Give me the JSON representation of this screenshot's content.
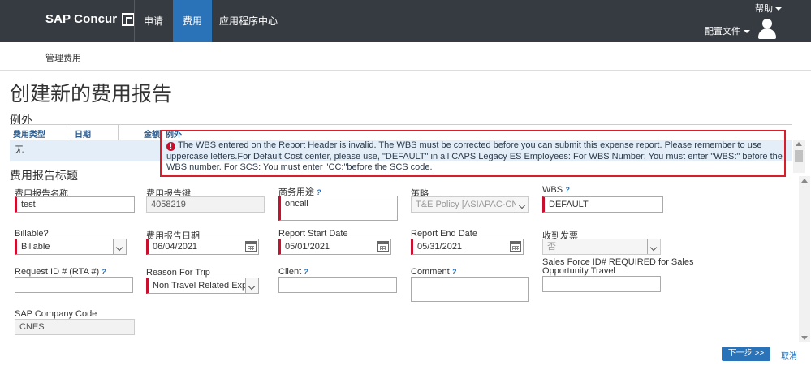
{
  "nav": {
    "brand": "SAP Concur",
    "tabs": [
      "申请",
      "费用",
      "应用程序中心"
    ],
    "help": "帮助",
    "profile": "配置文件"
  },
  "subnav": {
    "manage": "管理费用"
  },
  "page": {
    "title": "创建新的费用报告"
  },
  "exceptions": {
    "title": "例外",
    "columns": [
      "费用类型",
      "日期",
      "金额",
      "例外"
    ],
    "row_value": "无",
    "message": "The WBS entered on the Report Header is invalid. The WBS must be corrected before you can submit this expense report. Please remember to use uppercase letters.For Default Cost center, please use, \"DEFAULT\" in all CAPS Legacy ES Employees: For WBS Number: You must enter \"WBS:\" before the WBS number. For SCS: You must enter \"CC:\"before the SCS code."
  },
  "form": {
    "section_title": "费用报告标题",
    "report_name": {
      "label": "费用报告名称",
      "value": "test"
    },
    "report_key": {
      "label": "费用报告键",
      "value": "4058219"
    },
    "business_purpose": {
      "label": "商务用途",
      "value": "oncall"
    },
    "policy": {
      "label": "策略",
      "value": "T&E Policy [ASIAPAC-CN]"
    },
    "wbs": {
      "label": "WBS",
      "value": "DEFAULT"
    },
    "billable": {
      "label": "Billable?",
      "value": "Billable"
    },
    "report_date": {
      "label": "费用报告日期",
      "value": "06/04/2021"
    },
    "start_date": {
      "label": "Report Start Date",
      "value": "05/01/2021"
    },
    "end_date": {
      "label": "Report End Date",
      "value": "05/31/2021"
    },
    "receipt": {
      "label": "收到发票",
      "value": "否"
    },
    "request_id": {
      "label": "Request ID # (RTA #)",
      "value": ""
    },
    "reason": {
      "label": "Reason For Trip",
      "value": "Non Travel Related Expen"
    },
    "client": {
      "label": "Client",
      "value": ""
    },
    "comment": {
      "label": "Comment",
      "value": ""
    },
    "sales_force": {
      "label_line1": "Sales Force ID# REQUIRED for Sales",
      "label_line2": "Opportunity Travel",
      "value": ""
    },
    "company_code": {
      "label": "SAP Company Code",
      "value": "CNES"
    }
  },
  "actions": {
    "next": "下一步 >>",
    "cancel": "取消"
  },
  "colors": {
    "nav_bg": "#363b41",
    "accent": "#2a73b9",
    "error": "#d81e2b",
    "required": "#c8102e"
  }
}
